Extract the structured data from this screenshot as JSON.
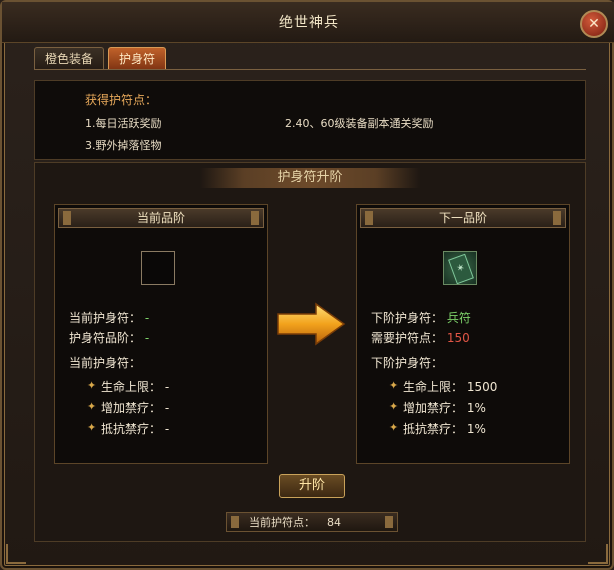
{
  "window": {
    "title": "绝世神兵",
    "close_icon": "close-icon"
  },
  "tabs": [
    {
      "label": "橙色装备",
      "active": false
    },
    {
      "label": "护身符",
      "active": true
    }
  ],
  "info": {
    "title": "获得护符点：",
    "items": [
      "1.每日活跃奖励",
      "2.40、60级装备副本通关奖励",
      "3.野外掉落怪物"
    ]
  },
  "section_title": "护身符升阶",
  "current": {
    "header": "当前品阶",
    "rows": [
      {
        "label": "当前护身符：",
        "value": "-"
      },
      {
        "label": "护身符品阶：",
        "value": "-"
      }
    ],
    "stats_title": "当前护身符：",
    "stats": [
      {
        "label": "生命上限：",
        "value": "-"
      },
      {
        "label": "增加禁疗：",
        "value": "-"
      },
      {
        "label": "抵抗禁疗：",
        "value": "-"
      }
    ]
  },
  "next": {
    "header": "下一品阶",
    "icon": "amulet-icon",
    "rows": [
      {
        "label": "下阶护身符：",
        "value": "兵符"
      },
      {
        "label": "需要护符点：",
        "value": "150"
      }
    ],
    "stats_title": "下阶护身符：",
    "stats": [
      {
        "label": "生命上限：",
        "value": "1500"
      },
      {
        "label": "增加禁疗：",
        "value": "1%"
      },
      {
        "label": "抵抗禁疗：",
        "value": "1%"
      }
    ]
  },
  "upgrade_button": "升阶",
  "points": {
    "label": "当前护符点：",
    "value": "84"
  },
  "colors": {
    "accent": "#e6a85a",
    "green": "#7ed36a",
    "red": "#e05545"
  }
}
